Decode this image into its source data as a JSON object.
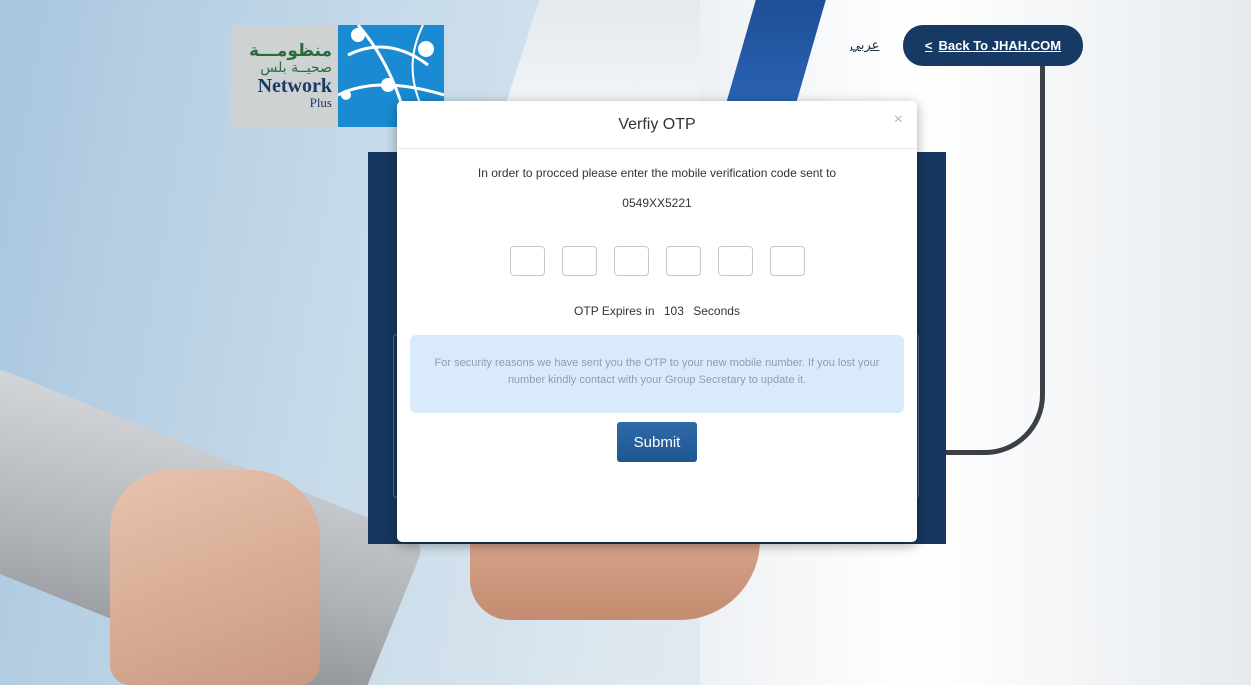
{
  "header": {
    "logo": {
      "arabic_line1": "منظومـــة",
      "arabic_line2": "صحيــة بلس",
      "english_line1": "Network",
      "english_line2": "Plus"
    },
    "language_link": "عربي",
    "back_button_label": "Back To JHAH.COM"
  },
  "modal": {
    "title": "Verfiy OTP",
    "close_symbol": "×",
    "instruction": "In order to procced please enter the mobile verification code sent to",
    "mobile_number": "0549XX5221",
    "otp_fields": [
      "",
      "",
      "",
      "",
      "",
      ""
    ],
    "expiry": {
      "prefix": "OTP Expires in",
      "seconds": "103",
      "suffix": "Seconds"
    },
    "security_notice": "For security reasons we have sent you the OTP to your new mobile number. If you lost your number kindly contact with your Group Secretary to update it.",
    "submit_label": "Submit"
  },
  "colors": {
    "navy": "#16375e",
    "submit_blue": "#2e6ba8",
    "alert_bg": "#d9ebfb",
    "logo_blue": "#1a8bd3"
  },
  "icons": {
    "back_chevron": "chevron-left-icon",
    "close": "close-icon",
    "logo_network": "network-nodes-icon"
  }
}
